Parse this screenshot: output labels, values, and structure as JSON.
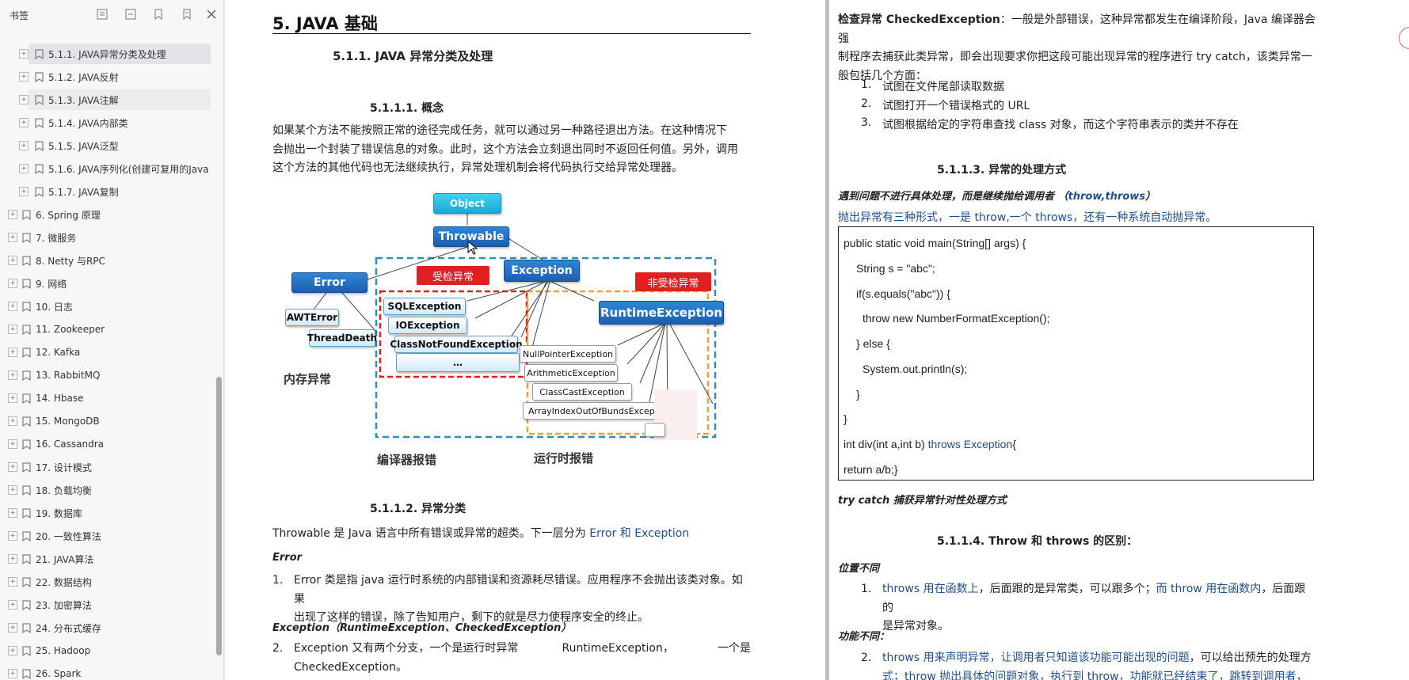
{
  "sidebar": {
    "title": "书签",
    "items": [
      {
        "label": "5.1.1. JAVA异常分类及处理",
        "level": 2,
        "state": "active"
      },
      {
        "label": "5.1.2. JAVA反射",
        "level": 2,
        "state": ""
      },
      {
        "label": "5.1.3. JAVA注解",
        "level": 2,
        "state": "hover"
      },
      {
        "label": "5.1.4. JAVA内部类",
        "level": 2,
        "state": ""
      },
      {
        "label": "5.1.5. JAVA泛型",
        "level": 2,
        "state": ""
      },
      {
        "label": "5.1.6. JAVA序列化(创建可复用的Java",
        "level": 2,
        "state": ""
      },
      {
        "label": "5.1.7. JAVA复制",
        "level": 2,
        "state": ""
      },
      {
        "label": "6. Spring 原理",
        "level": 1,
        "state": ""
      },
      {
        "label": "7.    微服务",
        "level": 1,
        "state": ""
      },
      {
        "label": "8. Netty 与RPC",
        "level": 1,
        "state": ""
      },
      {
        "label": "9. 网络",
        "level": 1,
        "state": ""
      },
      {
        "label": "10. 日志",
        "level": 1,
        "state": ""
      },
      {
        "label": "11. Zookeeper",
        "level": 1,
        "state": ""
      },
      {
        "label": "12. Kafka",
        "level": 1,
        "state": ""
      },
      {
        "label": "13. RabbitMQ",
        "level": 1,
        "state": ""
      },
      {
        "label": "14. Hbase",
        "level": 1,
        "state": ""
      },
      {
        "label": "15. MongoDB",
        "level": 1,
        "state": ""
      },
      {
        "label": "16. Cassandra",
        "level": 1,
        "state": ""
      },
      {
        "label": "17. 设计模式",
        "level": 1,
        "state": ""
      },
      {
        "label": "18. 负载均衡",
        "level": 1,
        "state": ""
      },
      {
        "label": "19. 数据库",
        "level": 1,
        "state": ""
      },
      {
        "label": "20. 一致性算法",
        "level": 1,
        "state": ""
      },
      {
        "label": "21. JAVA算法",
        "level": 1,
        "state": ""
      },
      {
        "label": "22. 数据结构",
        "level": 1,
        "state": ""
      },
      {
        "label": "23. 加密算法",
        "level": 1,
        "state": ""
      },
      {
        "label": "24. 分布式缓存",
        "level": 1,
        "state": ""
      },
      {
        "label": "25. Hadoop",
        "level": 1,
        "state": ""
      },
      {
        "label": "26. Spark",
        "level": 1,
        "state": ""
      }
    ]
  },
  "left": {
    "h1": "5. JAVA 基础",
    "h2": "5.1.1.  JAVA 异常分类及处理",
    "h3_concept": "5.1.1.1.      概念",
    "concept_lines": [
      "    如果某个方法不能按照正常的途径完成任务，就可以通过另一种路径退出方法。在这种情况下",
      "会抛出一个封装了错误信息的对象。此时，这个方法会立刻退出同时不返回任何值。另外，调用",
      "这个方法的其他代码也无法继续执行，异常处理机制会将代码执行交给异常处理器。"
    ],
    "h3_classify": "5.1.1.2.      异常分类",
    "throwable_intro": "Throwable 是 Java 语言中所有错误或异常的超类。下一层分为 ",
    "throwable_intro_blue": "Error 和 Exception",
    "error_label": "Error",
    "item1_num": "1.",
    "item1_lines": [
      "Error 类是指 java 运行时系统的内部错误和资源耗尽错误。应用程序不会抛出该类对象。如果",
      "出现了这样的错误，除了告知用户，剩下的就是尽力使程序安全的终止。"
    ],
    "exception_label": "Exception（RuntimeException、CheckedException）",
    "item2_num": "2.",
    "item2_line1_a": "Exception 又有两个分支，一个是运行时异常",
    "item2_line1_b": "RuntimeException，",
    "item2_line1_c": "一个是",
    "item2_line2": "CheckedException。"
  },
  "diagram": {
    "object": "Object",
    "throwable": "Throwable",
    "error": "Error",
    "exception": "Exception",
    "runtime_exception": "RuntimeException",
    "checked_tag": "受检异常",
    "unchecked_tag": "非受检异常",
    "awt_error": "AWTError",
    "thread_death": "ThreadDeath",
    "sql_exception": "SQLException",
    "io_exception": "IOException",
    "class_not_found": "ClassNotFoundException",
    "ellipsis": "…",
    "null_pointer": "NullPointerException",
    "arithmetic": "ArithmeticException",
    "class_cast": "ClassCastException",
    "array_index": "ArrayIndexOutOfBundsExcep",
    "label_memory": "内存异常",
    "label_compile": "编译器报错",
    "label_runtime": "运行时报错"
  },
  "right": {
    "checked_title": "检查异常 CheckedException",
    "checked_line1": "：一般是外部错误，这种异常都发生在编译阶段，Java 编译器会强",
    "checked_line2": "制程序去捕获此类异常，即会出现要求你把这段可能出现异常的程序进行 try catch，该类异常一",
    "checked_line3": "般包括几个方面：",
    "cases": [
      {
        "num": "1.",
        "text": "试图在文件尾部读取数据"
      },
      {
        "num": "2.",
        "text": "试图打开一个错误格式的 URL"
      },
      {
        "num": "3.",
        "text": "试图根据给定的字符串查找 class 对象，而这个字符串表示的类并不存在"
      }
    ],
    "h3_handling": "5.1.1.3.      异常的处理方式",
    "throw_up_note": "遇到问题不进行具体处理，而是继续抛给调用者 （",
    "throw_up_note_blue": "throw,throws",
    "throw_up_note_end": "）",
    "throw_forms": "抛出异常有三种形式，一是 throw,一个 throws，还有一种系统自动抛异常。",
    "code": [
      "public static void main(String[] args) {",
      "String s = \"abc\";",
      "if(s.equals(\"abc\")) {",
      "throw new NumberFormatException();",
      "} else {",
      "System.out.println(s);",
      "}",
      "}",
      "return a/b;}"
    ],
    "code_div_a": "int div(int a,int b) ",
    "code_div_b": "throws Exception",
    "code_div_c": "{",
    "try_catch_note": "try catch 捕获异常针对性处理方式",
    "h3_throw": "5.1.1.4.      Throw 和 throws 的区别：",
    "position_label": "位置不同",
    "r1_num": "1.",
    "r1_a": "throws 用在函数上",
    "r1_b": "，后面跟的是异常类，可以跟多个；",
    "r1_c": "而 throw 用在函数内",
    "r1_d": "，后面跟的",
    "r1_line2": "是异常对象。",
    "function_label": "功能不同：",
    "r2_num": "2.",
    "r2_a": "throws 用来声明异常，让调用者只知道该功能可能出现的问题",
    "r2_b": "，可以给出预先的处理方",
    "r2_line2": "式；throw 抛出具体的问题对象，执行到 throw，功能就已经结束了，跳转到调用者，并"
  }
}
